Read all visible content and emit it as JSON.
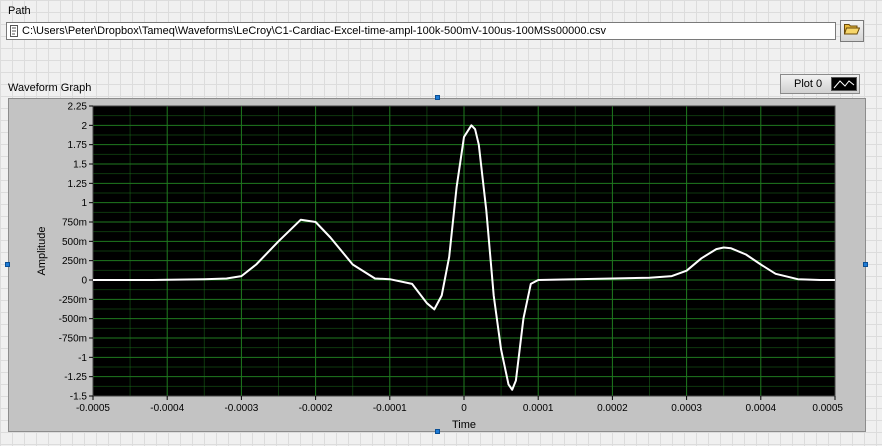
{
  "path_control": {
    "label": "Path",
    "value": "C:\\Users\\Peter\\Dropbox\\Tameq\\Waveforms\\LeCroy\\C1-Cardiac-Excel-time-ampl-100k-500mV-100us-100MSs00000.csv",
    "browse_icon": "folder-open-icon"
  },
  "graph": {
    "label": "Waveform Graph",
    "plot_legend": {
      "name": "Plot 0",
      "icon": "line-style-icon"
    },
    "colors": {
      "plot_background": "#000000",
      "grid": "#1f7a1f",
      "trace": "#ffffff"
    }
  },
  "chart_data": {
    "type": "line",
    "xlabel": "Time",
    "ylabel": "Amplitude",
    "xlim": [
      -0.0005,
      0.0005
    ],
    "ylim": [
      -1.5,
      2.25
    ],
    "x_ticks": [
      "-0.0005",
      "-0.0004",
      "-0.0003",
      "-0.0002",
      "-0.0001",
      "0",
      "0.0001",
      "0.0002",
      "0.0003",
      "0.0004",
      "0.0005"
    ],
    "x_tick_values": [
      -0.0005,
      -0.0004,
      -0.0003,
      -0.0002,
      -0.0001,
      0,
      0.0001,
      0.0002,
      0.0003,
      0.0004,
      0.0005
    ],
    "y_ticks": [
      "2.25",
      "2",
      "1.75",
      "1.5",
      "1.25",
      "1",
      "750m",
      "500m",
      "250m",
      "0",
      "-250m",
      "-500m",
      "-750m",
      "-1",
      "-1.25",
      "-1.5"
    ],
    "y_tick_values": [
      2.25,
      2,
      1.75,
      1.5,
      1.25,
      1,
      0.75,
      0.5,
      0.25,
      0,
      -0.25,
      -0.5,
      -0.75,
      -1,
      -1.25,
      -1.5
    ],
    "grid": true,
    "series": [
      {
        "name": "Plot 0",
        "x": [
          -0.0005,
          -0.00042,
          -0.00035,
          -0.00032,
          -0.0003,
          -0.00028,
          -0.00025,
          -0.00022,
          -0.0002,
          -0.00018,
          -0.00015,
          -0.00012,
          -0.0001,
          -7e-05,
          -5e-05,
          -4e-05,
          -3e-05,
          -2e-05,
          -1e-05,
          0,
          1e-05,
          1.5e-05,
          2e-05,
          3e-05,
          4e-05,
          5e-05,
          6e-05,
          6.5e-05,
          7e-05,
          8e-05,
          9e-05,
          0.0001,
          0.00015,
          0.0002,
          0.00025,
          0.00028,
          0.0003,
          0.00032,
          0.00034,
          0.00035,
          0.00036,
          0.00038,
          0.0004,
          0.00042,
          0.00045,
          0.00048,
          0.0005
        ],
        "y": [
          0,
          0,
          0.01,
          0.02,
          0.05,
          0.2,
          0.5,
          0.78,
          0.75,
          0.55,
          0.2,
          0.02,
          0.01,
          -0.05,
          -0.3,
          -0.38,
          -0.2,
          0.3,
          1.2,
          1.85,
          2.0,
          1.95,
          1.75,
          0.9,
          -0.2,
          -0.9,
          -1.35,
          -1.42,
          -1.3,
          -0.5,
          -0.05,
          0,
          0.01,
          0.02,
          0.03,
          0.05,
          0.12,
          0.28,
          0.4,
          0.42,
          0.41,
          0.33,
          0.2,
          0.08,
          0.01,
          0,
          0
        ]
      }
    ]
  }
}
